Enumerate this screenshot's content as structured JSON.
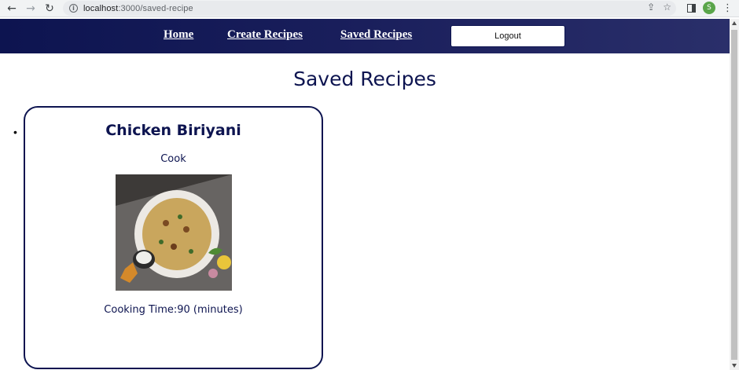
{
  "browser": {
    "url_host": "localhost",
    "url_path": ":3000/saved-recipe",
    "profile_initial": "S"
  },
  "nav": {
    "home_label": "Home",
    "create_label": "Create Recipes",
    "saved_label": "Saved Recipes",
    "logout_label": "Logout"
  },
  "page": {
    "title": "Saved Recipes"
  },
  "recipes": [
    {
      "name": "Chicken Biriyani",
      "instructions": "Cook",
      "cooking_time": "Cooking Time:90 (minutes)"
    }
  ],
  "colors": {
    "brand_navy": "#0d1450",
    "profile_green": "#5aa54a"
  },
  "icons": [
    "back-arrow-icon",
    "forward-arrow-icon",
    "reload-icon",
    "info-icon",
    "share-icon",
    "star-icon",
    "side-panel-icon",
    "kebab-menu-icon"
  ]
}
